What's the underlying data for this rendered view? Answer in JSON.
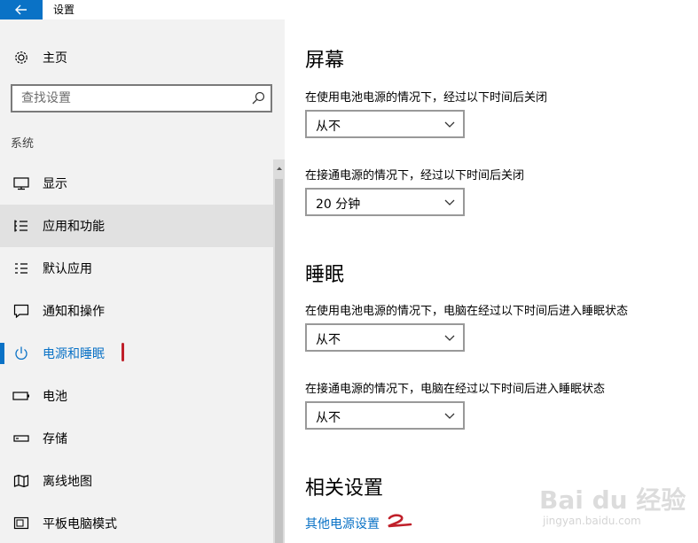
{
  "window": {
    "title": "设置"
  },
  "sidebar": {
    "home_label": "主页",
    "search_placeholder": "查找设置",
    "section_label": "系统",
    "items": [
      {
        "label": "显示",
        "icon": "display-icon"
      },
      {
        "label": "应用和功能",
        "icon": "apps-list-icon"
      },
      {
        "label": "默认应用",
        "icon": "default-apps-icon"
      },
      {
        "label": "通知和操作",
        "icon": "notification-icon"
      },
      {
        "label": "电源和睡眠",
        "icon": "power-icon"
      },
      {
        "label": "电池",
        "icon": "battery-icon"
      },
      {
        "label": "存储",
        "icon": "storage-icon"
      },
      {
        "label": "离线地图",
        "icon": "map-icon"
      },
      {
        "label": "平板电脑模式",
        "icon": "tablet-icon"
      }
    ],
    "selected_index": 4,
    "hover_index": 1
  },
  "main": {
    "screen": {
      "heading": "屏幕",
      "battery_caption": "在使用电池电源的情况下，经过以下时间后关闭",
      "battery_value": "从不",
      "plugged_caption": "在接通电源的情况下，经过以下时间后关闭",
      "plugged_value": "20 分钟"
    },
    "sleep": {
      "heading": "睡眠",
      "battery_caption": "在使用电池电源的情况下，电脑在经过以下时间后进入睡眠状态",
      "battery_value": "从不",
      "plugged_caption": "在接通电源的情况下，电脑在经过以下时间后进入睡眠状态",
      "plugged_value": "从不"
    },
    "related": {
      "heading": "相关设置",
      "link_label": "其他电源设置"
    }
  },
  "watermark": {
    "text": "Bai du 经验",
    "url": "jingyan.baidu.com"
  },
  "colors": {
    "accent": "#0a72c6",
    "sidebar_bg": "#f2f2f2",
    "hover_bg": "#e1e1e1",
    "annotation_red": "#c0202a"
  }
}
